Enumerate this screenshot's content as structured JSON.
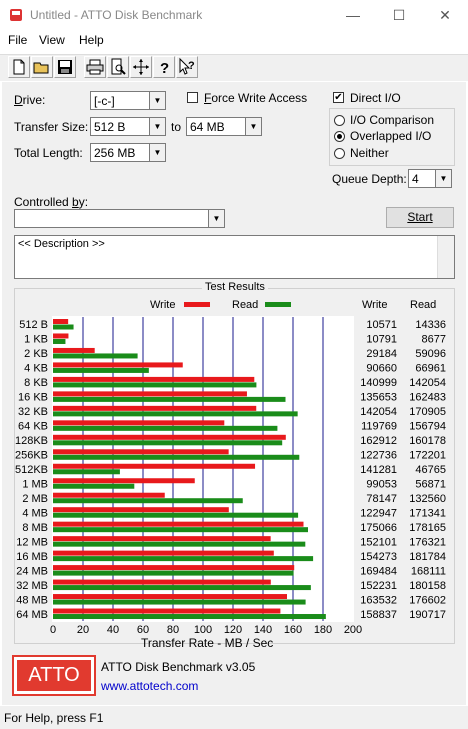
{
  "window": {
    "title": "Untitled - ATTO Disk Benchmark",
    "minimize": "—",
    "maximize": "☐",
    "close": "✕"
  },
  "menu": {
    "file": "File",
    "view": "View",
    "help": "Help"
  },
  "labels": {
    "drive": "Drive:",
    "transfer_size": "Transfer Size:",
    "to": "to",
    "total_length": "Total Length:",
    "force_write": "Force Write Access",
    "direct_io": "Direct I/O",
    "io_comparison": "I/O Comparison",
    "overlapped_io": "Overlapped I/O",
    "neither": "Neither",
    "queue_depth": "Queue Depth:",
    "controlled_by": "Controlled by:",
    "start": "Start",
    "description": "<< Description >>",
    "test_results": "Test Results",
    "legend_write": "Write",
    "legend_read": "Read",
    "col_write": "Write",
    "col_read": "Read",
    "xlabel": "Transfer Rate - MB / Sec"
  },
  "values": {
    "drive": "[-c-]",
    "transfer_from": "512 B",
    "transfer_to": "64 MB",
    "total_length": "256 MB",
    "queue_depth": "4",
    "controlled_by": ""
  },
  "state": {
    "force_write": false,
    "direct_io": true,
    "mode": "overlapped"
  },
  "colors": {
    "write": "#e8191c",
    "read": "#1a8c1a",
    "grid": "#1a1a8c",
    "atto_red": "#e13a2f"
  },
  "chart_data": {
    "type": "bar",
    "title": "Test Results",
    "xlabel": "Transfer Rate - MB / Sec",
    "xlim": [
      0,
      200
    ],
    "xticks": [
      "0",
      "20",
      "40",
      "60",
      "80",
      "100",
      "120",
      "140",
      "160",
      "180",
      "200"
    ],
    "categories": [
      "512 B",
      "1 KB",
      "2 KB",
      "4 KB",
      "8 KB",
      "16 KB",
      "32 KB",
      "64 KB",
      "128KB",
      "256KB",
      "512KB",
      "1 MB",
      "2 MB",
      "4 MB",
      "8 MB",
      "12 MB",
      "16 MB",
      "24 MB",
      "32 MB",
      "48 MB",
      "64 MB"
    ],
    "series": [
      {
        "name": "Write",
        "values": [
          10.1,
          10.3,
          27.8,
          86.5,
          134.2,
          129.3,
          135.5,
          114.2,
          155.2,
          117.1,
          134.7,
          94.5,
          74.5,
          117.2,
          167.0,
          145.1,
          147.2,
          160.8,
          145.2,
          156.0,
          151.6
        ],
        "labels": [
          "10571",
          "10791",
          "29184",
          "90660",
          "140999",
          "135653",
          "142054",
          "119769",
          "162912",
          "122736",
          "141281",
          "99053",
          "78147",
          "122947",
          "175066",
          "152101",
          "154273",
          "169484",
          "152231",
          "163532",
          "158837"
        ]
      },
      {
        "name": "Read",
        "values": [
          13.7,
          8.3,
          56.4,
          63.9,
          135.6,
          155.0,
          163.1,
          149.6,
          152.8,
          164.2,
          44.6,
          54.2,
          126.5,
          163.4,
          170.0,
          168.2,
          173.4,
          160.4,
          171.9,
          168.4,
          181.9
        ],
        "labels": [
          "14336",
          "8677",
          "59096",
          "66961",
          "142054",
          "162483",
          "170905",
          "156794",
          "160178",
          "172201",
          "46765",
          "56871",
          "132560",
          "171341",
          "178165",
          "176321",
          "181784",
          "168111",
          "180158",
          "176602",
          "190717"
        ]
      }
    ]
  },
  "footer": {
    "logo": "ATTO",
    "product": "ATTO Disk Benchmark v3.05",
    "url": "www.attotech.com"
  },
  "status": "For Help, press F1"
}
